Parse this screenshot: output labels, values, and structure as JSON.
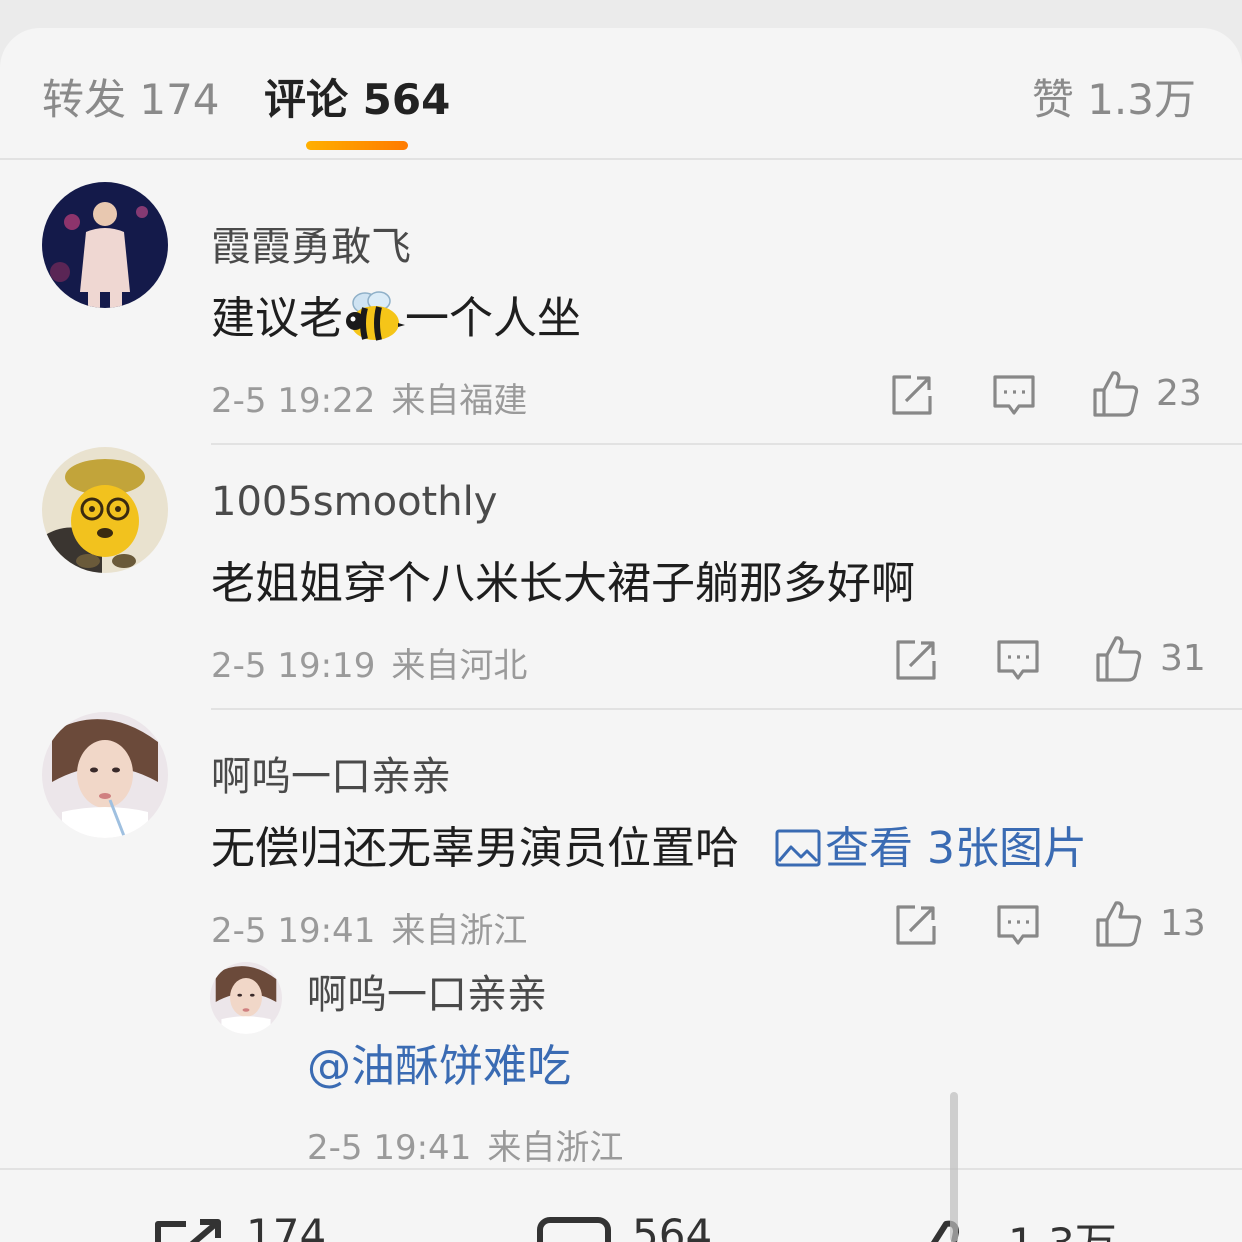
{
  "tabs": {
    "repost": "转发 174",
    "comment": "评论 564",
    "like": "赞 1.3万"
  },
  "comments": [
    {
      "username": "霞霞勇敢飞",
      "text_before": "建议老",
      "emoji": "bee-emoji",
      "text_after": "一个人坐",
      "date": "2-5 19:22",
      "location": "来自福建",
      "likes": "23"
    },
    {
      "username": "1005smoothly",
      "text": "老姐姐穿个八米长大裙子躺那多好啊",
      "date": "2-5 19:19",
      "location": "来自河北",
      "likes": "31"
    },
    {
      "username": "啊呜一口亲亲",
      "text": "无偿归还无辜男演员位置哈",
      "image_link": "查看 3张图片",
      "date": "2-5 19:41",
      "location": "来自浙江",
      "likes": "13"
    }
  ],
  "reply": {
    "username": "啊呜一口亲亲",
    "mention": "@油酥饼难吃",
    "date": "2-5 19:41",
    "location": "来自浙江"
  },
  "bottom_bar": {
    "repost_count": "174",
    "comment_count": "564",
    "like_count": "1.3万"
  },
  "icons": {
    "share": "share-icon",
    "reply": "reply-icon",
    "like": "thumbs-up-icon",
    "image": "image-icon"
  },
  "colors": {
    "accent_gradient_start": "#ffb000",
    "accent_gradient_end": "#ff7a00",
    "link": "#3a6bb3"
  }
}
